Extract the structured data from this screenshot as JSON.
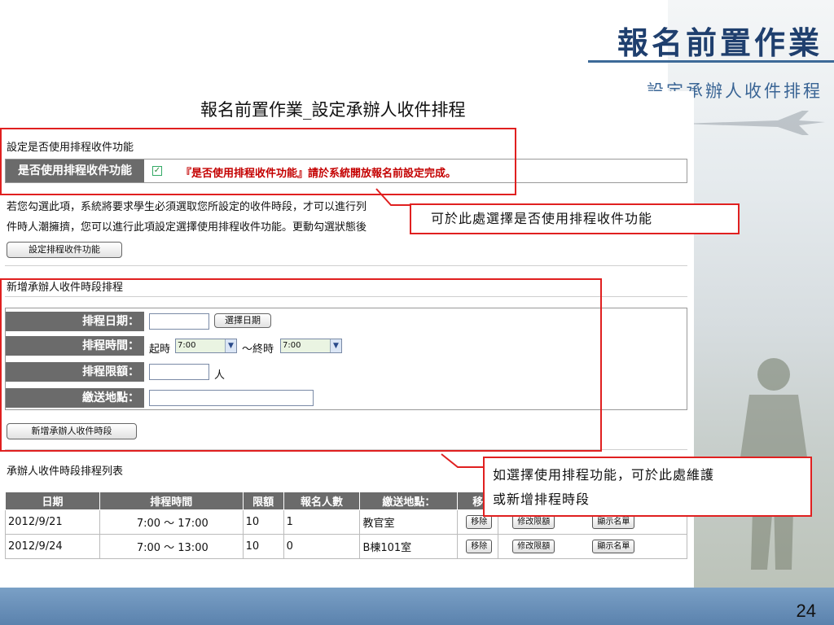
{
  "slide": {
    "title": "報名前置作業",
    "subtitle": "設定承辦人收件排程",
    "page_number": "24"
  },
  "page": {
    "heading": "報名前置作業_設定承辦人收件排程"
  },
  "settings": {
    "section_title": "設定是否使用排程收件功能",
    "row_label": "是否使用排程收件功能",
    "checkbox_checked": true,
    "notice": "『是否使用排程收件功能』請於系統開放報名前設定完成。",
    "para_line1": "若您勾選此項，系統將要求學生必須選取您所設定的收件時段，才可以進行列",
    "para_line2": "件時人潮擁擠，您可以進行此項設定選擇使用排程收件功能。更動勾選狀態後",
    "button": "設定排程收件功能"
  },
  "new_schedule": {
    "section_title": "新增承辦人收件時段排程",
    "date_label": "排程日期：",
    "date_value": "",
    "date_button": "選擇日期",
    "time_label": "排程時間：",
    "start_prefix": "起時",
    "start_value": "7:00",
    "separator": "～終時",
    "end_value": "7:00",
    "quota_label": "排程限額：",
    "quota_value": "",
    "quota_unit": "人",
    "place_label": "繳送地點：",
    "place_value": "",
    "add_button": "新增承辦人收件時段"
  },
  "schedule_list": {
    "section_title": "承辦人收件時段排程列表",
    "columns": [
      "日期",
      "排程時間",
      "限額",
      "報名人數",
      "繳送地點：",
      "移"
    ],
    "rows": [
      {
        "date": "2012/9/21",
        "time": "7:00 ～ 17:00",
        "quota": "10",
        "count": "1",
        "place": "教官室",
        "remove": "移除",
        "edit": "修改限額",
        "show": "顯示名單"
      },
      {
        "date": "2012/9/24",
        "time": "7:00 ～ 13:00",
        "quota": "10",
        "count": "0",
        "place": "B棟101室",
        "remove": "移除",
        "edit": "修改限額",
        "show": "顯示名單"
      }
    ]
  },
  "callouts": {
    "first": "可於此處選擇是否使用排程收件功能",
    "second_line1": "如選擇使用排程功能，可於此處維護",
    "second_line2": "或新增排程時段"
  },
  "colors": {
    "title": "#1f3f6e",
    "annotation": "#e02020",
    "notice": "#c40000",
    "header_cell": "#6b6b6b",
    "footer": "#5b82ad"
  }
}
